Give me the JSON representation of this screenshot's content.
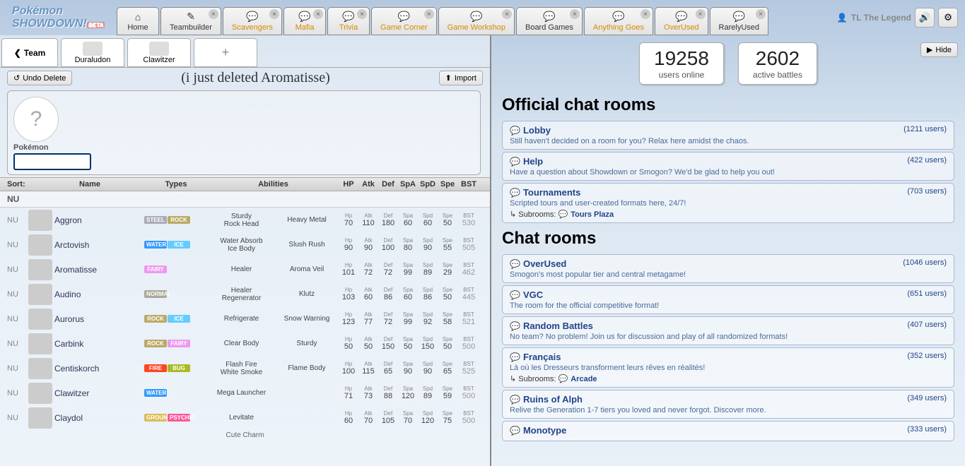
{
  "header": {
    "tabs": [
      {
        "id": "home",
        "label": "Home",
        "icon": "⌂"
      },
      {
        "id": "teambuilder",
        "label": "Teambuilder",
        "icon": "✎"
      },
      {
        "id": "scavengers",
        "label": "Scavengers",
        "room": true
      },
      {
        "id": "mafia",
        "label": "Mafia",
        "room": true
      },
      {
        "id": "trivia",
        "label": "Trivia",
        "room": true
      },
      {
        "id": "corner",
        "label": "Game Corner",
        "room": true
      },
      {
        "id": "workshop",
        "label": "Game Workshop",
        "room": true
      },
      {
        "id": "board",
        "label": "Board Games",
        "room": false
      },
      {
        "id": "ag",
        "label": "Anything Goes",
        "room": true
      },
      {
        "id": "ou",
        "label": "OverUsed",
        "room": true
      },
      {
        "id": "ru",
        "label": "RarelyUsed",
        "room": false
      }
    ],
    "username": "TL The Legend"
  },
  "teamtabs": {
    "back": "Team",
    "mon1": "Duraludon",
    "mon2": "Clawitzer"
  },
  "topbar": {
    "undo": "Undo Delete",
    "note": "(i just deleted Aromatisse)",
    "import": "Import"
  },
  "pokecard": {
    "label": "Pokémon"
  },
  "sort": {
    "label": "Sort:",
    "name": "Name",
    "types": "Types",
    "abilities": "Abilities",
    "hp": "HP",
    "atk": "Atk",
    "def": "Def",
    "spa": "SpA",
    "spd": "SpD",
    "spe": "Spe",
    "bst": "BST"
  },
  "tier": "NU",
  "dex": [
    {
      "tier": "NU",
      "name": "Aggron",
      "types": [
        "Steel",
        "Rock"
      ],
      "ab1": "Sturdy",
      "ab2": "Rock Head",
      "ha": "Heavy Metal",
      "hp": 70,
      "atk": 110,
      "def": 180,
      "spa": 60,
      "spd": 60,
      "spe": 50,
      "bst": 530
    },
    {
      "tier": "NU",
      "name": "Arctovish",
      "types": [
        "Water",
        "Ice"
      ],
      "ab1": "Water Absorb",
      "ab2": "Ice Body",
      "ha": "Slush Rush",
      "hp": 90,
      "atk": 90,
      "def": 100,
      "spa": 80,
      "spd": 90,
      "spe": 55,
      "bst": 505
    },
    {
      "tier": "NU",
      "name": "Aromatisse",
      "types": [
        "Fairy"
      ],
      "ab1": "Healer",
      "ab2": "",
      "ha": "Aroma Veil",
      "hp": 101,
      "atk": 72,
      "def": 72,
      "spa": 99,
      "spd": 89,
      "spe": 29,
      "bst": 462
    },
    {
      "tier": "NU",
      "name": "Audino",
      "types": [
        "Normal"
      ],
      "ab1": "Healer",
      "ab2": "Regenerator",
      "ha": "Klutz",
      "hp": 103,
      "atk": 60,
      "def": 86,
      "spa": 60,
      "spd": 86,
      "spe": 50,
      "bst": 445
    },
    {
      "tier": "NU",
      "name": "Aurorus",
      "types": [
        "Rock",
        "Ice"
      ],
      "ab1": "Refrigerate",
      "ab2": "",
      "ha": "Snow Warning",
      "hp": 123,
      "atk": 77,
      "def": 72,
      "spa": 99,
      "spd": 92,
      "spe": 58,
      "bst": 521
    },
    {
      "tier": "NU",
      "name": "Carbink",
      "types": [
        "Rock",
        "Fairy"
      ],
      "ab1": "Clear Body",
      "ab2": "",
      "ha": "Sturdy",
      "hp": 50,
      "atk": 50,
      "def": 150,
      "spa": 50,
      "spd": 150,
      "spe": 50,
      "bst": 500
    },
    {
      "tier": "NU",
      "name": "Centiskorch",
      "types": [
        "Fire",
        "Bug"
      ],
      "ab1": "Flash Fire",
      "ab2": "White Smoke",
      "ha": "Flame Body",
      "hp": 100,
      "atk": 115,
      "def": 65,
      "spa": 90,
      "spd": 90,
      "spe": 65,
      "bst": 525
    },
    {
      "tier": "NU",
      "name": "Clawitzer",
      "types": [
        "Water"
      ],
      "ab1": "Mega Launcher",
      "ab2": "",
      "ha": "",
      "hp": 71,
      "atk": 73,
      "def": 88,
      "spa": 120,
      "spd": 89,
      "spe": 59,
      "bst": 500
    },
    {
      "tier": "NU",
      "name": "Claydol",
      "types": [
        "Ground",
        "Psychic"
      ],
      "ab1": "Levitate",
      "ab2": "",
      "ha": "",
      "hp": 60,
      "atk": 70,
      "def": 105,
      "spa": 70,
      "spd": 120,
      "spe": 75,
      "bst": 500
    }
  ],
  "right": {
    "usersOnline": {
      "num": "19258",
      "lbl": "users online"
    },
    "activeBattles": {
      "num": "2602",
      "lbl": "active battles"
    },
    "hide": "Hide",
    "official": "Official chat rooms",
    "chatrooms": "Chat rooms",
    "rooms1": [
      {
        "name": "Lobby",
        "users": "(1211 users)",
        "desc": "Still haven't decided on a room for you? Relax here amidst the chaos."
      },
      {
        "name": "Help",
        "users": "(422 users)",
        "desc": "Have a question about Showdown or Smogon? We'd be glad to help you out!"
      },
      {
        "name": "Tournaments",
        "users": "(703 users)",
        "desc": "Scripted tours and user-created formats here, 24/7!",
        "sub": "Tours Plaza"
      }
    ],
    "rooms2": [
      {
        "name": "OverUsed",
        "users": "(1046 users)",
        "desc": "Smogon's most popular tier and central metagame!"
      },
      {
        "name": "VGC",
        "users": "(651 users)",
        "desc": "The room for the official competitive format!"
      },
      {
        "name": "Random Battles",
        "users": "(407 users)",
        "desc": "No team? No problem! Join us for discussion and play of all randomized formats!"
      },
      {
        "name": "Français",
        "users": "(352 users)",
        "desc": "Là où les Dresseurs transforment leurs rêves en réalités!",
        "sub": "Arcade"
      },
      {
        "name": "Ruins of Alph",
        "users": "(349 users)",
        "desc": "Relive the Generation 1-7 tiers you loved and never forgot. Discover more."
      },
      {
        "name": "Monotype",
        "users": "(333 users)",
        "desc": ""
      }
    ],
    "subrooms_label": "Subrooms:"
  }
}
